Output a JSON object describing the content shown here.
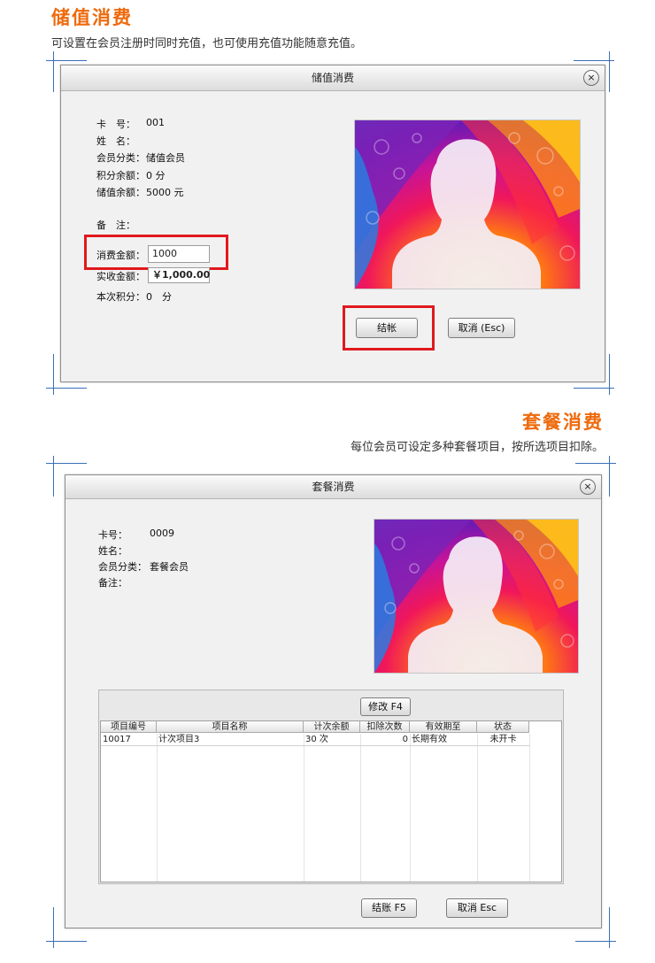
{
  "section1": {
    "heading": "储值消费",
    "description": "可设置在会员注册时同时充值，也可使用充值功能随意充值。"
  },
  "dialog1": {
    "title": "储值消费",
    "close": "×",
    "fields": [
      {
        "label": "卡　号：",
        "value": "001"
      },
      {
        "label": "姓　名：",
        "value": ""
      },
      {
        "label": "会员分类：",
        "value": "储值会员"
      },
      {
        "label": "积分余额：",
        "value": "0 分"
      },
      {
        "label": "储值余额：",
        "value": "5000 元"
      }
    ],
    "remark_label": "备　注：",
    "amount_label": "消费金额：",
    "amount_value": "1000",
    "received_label": "实收金额：",
    "received_value": "￥1,000.00",
    "points_label": "本次积分：",
    "points_value": "0　分",
    "checkout_button": "结帐",
    "cancel_button": "取消 (Esc)"
  },
  "section2": {
    "heading": "套餐消费",
    "description": "每位会员可设定多种套餐项目，按所选项目扣除。"
  },
  "dialog2": {
    "title": "套餐消费",
    "close": "×",
    "fields": [
      {
        "label": "卡号：",
        "value": "0009"
      },
      {
        "label": "姓名：",
        "value": ""
      },
      {
        "label": "会员分类：",
        "value": "套餐会员"
      },
      {
        "label": "备注：",
        "value": ""
      }
    ],
    "modify_button": "修改 F4",
    "columns": [
      "项目编号",
      "项目名称",
      "计次余额",
      "扣除次数",
      "有效期至",
      "状态"
    ],
    "rows": [
      [
        "10017",
        "计次项目3",
        "30 次",
        "0",
        "长期有效",
        "未开卡"
      ]
    ],
    "checkout_button": "结账 F5",
    "cancel_button": "取消 Esc"
  },
  "colors": {
    "accent": "#ee6a0c",
    "highlight": "#e0191e",
    "crop_marks": "#3a6fb7"
  }
}
